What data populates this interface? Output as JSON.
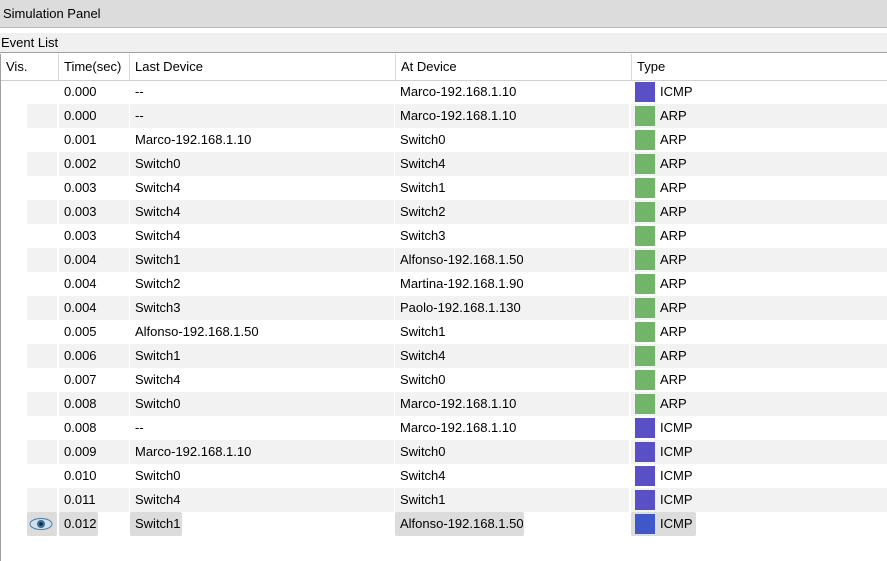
{
  "panel": {
    "title": "Simulation Panel"
  },
  "event_list": {
    "title": "Event List",
    "columns": [
      "Vis.",
      "Time(sec)",
      "Last Device",
      "At Device",
      "Type"
    ],
    "colors": {
      "ICMP": "#5b4fc6",
      "ICMP_selected": "#3e58c8",
      "ARP": "#72b46a"
    },
    "rows": [
      {
        "vis": "",
        "time": "0.000",
        "last": "--",
        "at": "Marco-192.168.1.10",
        "type": "ICMP"
      },
      {
        "vis": "",
        "time": "0.000",
        "last": "--",
        "at": "Marco-192.168.1.10",
        "type": "ARP"
      },
      {
        "vis": "",
        "time": "0.001",
        "last": "Marco-192.168.1.10",
        "at": "Switch0",
        "type": "ARP"
      },
      {
        "vis": "",
        "time": "0.002",
        "last": "Switch0",
        "at": "Switch4",
        "type": "ARP"
      },
      {
        "vis": "",
        "time": "0.003",
        "last": "Switch4",
        "at": "Switch1",
        "type": "ARP"
      },
      {
        "vis": "",
        "time": "0.003",
        "last": "Switch4",
        "at": "Switch2",
        "type": "ARP"
      },
      {
        "vis": "",
        "time": "0.003",
        "last": "Switch4",
        "at": "Switch3",
        "type": "ARP"
      },
      {
        "vis": "",
        "time": "0.004",
        "last": "Switch1",
        "at": "Alfonso-192.168.1.50",
        "type": "ARP"
      },
      {
        "vis": "",
        "time": "0.004",
        "last": "Switch2",
        "at": "Martina-192.168.1.90",
        "type": "ARP"
      },
      {
        "vis": "",
        "time": "0.004",
        "last": "Switch3",
        "at": "Paolo-192.168.1.130",
        "type": "ARP"
      },
      {
        "vis": "",
        "time": "0.005",
        "last": "Alfonso-192.168.1.50",
        "at": "Switch1",
        "type": "ARP"
      },
      {
        "vis": "",
        "time": "0.006",
        "last": "Switch1",
        "at": "Switch4",
        "type": "ARP"
      },
      {
        "vis": "",
        "time": "0.007",
        "last": "Switch4",
        "at": "Switch0",
        "type": "ARP"
      },
      {
        "vis": "",
        "time": "0.008",
        "last": "Switch0",
        "at": "Marco-192.168.1.10",
        "type": "ARP"
      },
      {
        "vis": "",
        "time": "0.008",
        "last": "--",
        "at": "Marco-192.168.1.10",
        "type": "ICMP"
      },
      {
        "vis": "",
        "time": "0.009",
        "last": "Marco-192.168.1.10",
        "at": "Switch0",
        "type": "ICMP"
      },
      {
        "vis": "",
        "time": "0.010",
        "last": "Switch0",
        "at": "Switch4",
        "type": "ICMP"
      },
      {
        "vis": "",
        "time": "0.011",
        "last": "Switch4",
        "at": "Switch1",
        "type": "ICMP"
      },
      {
        "vis": "eye-icon",
        "time": "0.012",
        "last": "Switch1",
        "at": "Alfonso-192.168.1.50",
        "type": "ICMP",
        "selected": true
      }
    ]
  }
}
